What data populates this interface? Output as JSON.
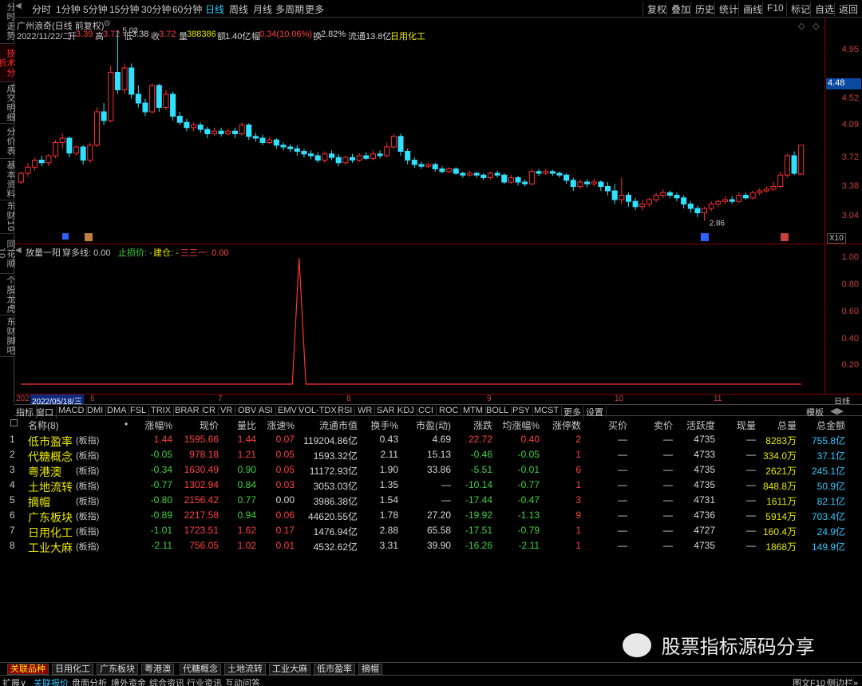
{
  "sidebar": [
    "分时走势",
    "技术分析",
    "成交明细",
    "分价表",
    "基本资料",
    "东财10",
    "同花顺10",
    "个股龙虎",
    "东财脚吧"
  ],
  "periods": [
    "分时",
    "1分钟",
    "5分钟",
    "15分钟",
    "30分钟",
    "60分钟",
    "日线",
    "周线",
    "月线",
    "多周期",
    "更多"
  ],
  "active_period": "日线",
  "right_menu": [
    "复权",
    "叠加",
    "历史",
    "统计",
    "画线",
    "F10",
    "标记",
    "自选",
    "返回"
  ],
  "info": {
    "stock_name": "广州浪奇(日线 前复权)",
    "date": "2022/11/22/二",
    "open_label": "开",
    "open": "3.39",
    "high_label": "高",
    "high": "3.72",
    "low_label": "低",
    "low": "3.38",
    "close_label": "收",
    "close": "3.72",
    "vol_label": "量",
    "vol": "388386",
    "amt_label": "额",
    "amt": "1.40亿",
    "chg_label": "幅",
    "chg": "0.34(10.06%)",
    "turn_label": "换",
    "turn": "2.82%",
    "float_label": "流通",
    "float": "13.8亿",
    "sector": "日用化工",
    "high_mark": "5.03",
    "low_mark": "2.86",
    "price_tag": "4.48"
  },
  "price_axis": [
    "4.95",
    "4.52",
    "4.09",
    "3.72",
    "3.38",
    "3.04"
  ],
  "x10": "X10",
  "sub": {
    "name": "放量一阳",
    "l1": "穿多线: 0.00",
    "l2": "止损价: -",
    "l3": "建仓: -",
    "l4": "三三一: 0.00"
  },
  "sub_axis": [
    "1.00",
    "0.80",
    "0.60",
    "0.40",
    "0.20"
  ],
  "dates": {
    "start": "2022/05/18/三",
    "prefix": "202",
    "months": [
      "6",
      "7",
      "8",
      "9",
      "10",
      "11"
    ],
    "period": "日线"
  },
  "indicators": [
    "指标",
    "窗口",
    "MACD",
    "DMI",
    "DMA",
    "FSL",
    "TRIX",
    "BRAR",
    "CR",
    "VR",
    "OBV",
    "ASI",
    "EMV",
    "VOL-TDX",
    "RSI",
    "WR",
    "SAR",
    "KDJ",
    "CCI",
    "ROC",
    "MTM",
    "BOLL",
    "PSY",
    "MCST",
    "更多",
    "设置"
  ],
  "template_label": "模板",
  "table": {
    "headers": [
      "名称(8)",
      "•",
      "涨幅%",
      "现价",
      "量比",
      "涨速%",
      "流通市值",
      "换手%",
      "市盈(动)",
      "涨跌",
      "均涨幅%",
      "涨停数",
      "买价",
      "卖价",
      "活跃度",
      "现量",
      "总量",
      "总金额"
    ],
    "rows": [
      [
        "1",
        "低市盈率",
        "(板指)",
        "1.44",
        "1595.66",
        "1.44",
        "0.07",
        "119204.86亿",
        "0.43",
        "4.69",
        "22.72",
        "0.40",
        "2",
        "—",
        "—",
        "4735",
        "—",
        "8283万",
        "755.8亿"
      ],
      [
        "2",
        "代糖概念",
        "(板指)",
        "-0.05",
        "978.18",
        "1.21",
        "0.05",
        "1593.32亿",
        "2.11",
        "15.13",
        "-0.46",
        "-0.05",
        "1",
        "—",
        "—",
        "4733",
        "—",
        "334.0万",
        "37.1亿"
      ],
      [
        "3",
        "粤港澳",
        "(板指)",
        "-0.34",
        "1630.49",
        "0.90",
        "0.05",
        "11172.93亿",
        "1.90",
        "33.86",
        "-5.51",
        "-0.01",
        "6",
        "—",
        "—",
        "4735",
        "—",
        "2621万",
        "245.1亿"
      ],
      [
        "4",
        "土地流转",
        "(板指)",
        "-0.77",
        "1302.94",
        "0.84",
        "0.03",
        "3053.03亿",
        "1.35",
        "—",
        "-10.14",
        "-0.77",
        "1",
        "—",
        "—",
        "4735",
        "—",
        "848.8万",
        "50.9亿"
      ],
      [
        "5",
        "摘帽",
        "(板指)",
        "-0.80",
        "2156.42",
        "0.77",
        "0.00",
        "3986.38亿",
        "1.54",
        "—",
        "-17.44",
        "-0.47",
        "3",
        "—",
        "—",
        "4731",
        "—",
        "1611万",
        "82.1亿"
      ],
      [
        "6",
        "广东板块",
        "(板指)",
        "-0.89",
        "2217.58",
        "0.94",
        "0.06",
        "44620.55亿",
        "1.78",
        "27.20",
        "-19.92",
        "-1.13",
        "9",
        "—",
        "—",
        "4736",
        "—",
        "5914万",
        "703.4亿"
      ],
      [
        "7",
        "日用化工",
        "(板指)",
        "-1.01",
        "1723.51",
        "1.62",
        "0.17",
        "1476.94亿",
        "2.88",
        "65.58",
        "-17.51",
        "-0.79",
        "1",
        "—",
        "—",
        "4727",
        "—",
        "160.4万",
        "24.9亿"
      ],
      [
        "8",
        "工业大麻",
        "(板指)",
        "-2.11",
        "756.05",
        "1.02",
        "0.01",
        "4532.62亿",
        "3.31",
        "39.90",
        "-16.26",
        "-2.11",
        "1",
        "—",
        "—",
        "4735",
        "—",
        "1868万",
        "149.9亿"
      ]
    ]
  },
  "watermark": "股票指标源码分享",
  "bottom_tabs": [
    "关联品种",
    "日用化工",
    "广东板块",
    "粤港澳",
    "代糖概念",
    "土地流转",
    "工业大麻",
    "低市盈率",
    "摘帽"
  ],
  "status": [
    "扩展∨",
    "关联报价",
    "盘面分析",
    "境外资金",
    "综合资讯",
    "行业资讯",
    "互动问答"
  ],
  "status_right": [
    "图文F10",
    "侧边栏»"
  ],
  "chart_data": {
    "type": "candlestick",
    "ylim": [
      2.7,
      5.1
    ],
    "price_labels": [
      "4.95",
      "4.52",
      "4.09",
      "3.72",
      "3.38",
      "3.04"
    ],
    "high": 5.03,
    "low": 2.86,
    "candles": [
      [
        3.3,
        3.4,
        3.28,
        3.42
      ],
      [
        3.4,
        3.47,
        3.36,
        3.52
      ],
      [
        3.47,
        3.55,
        3.43,
        3.58
      ],
      [
        3.55,
        3.52,
        3.48,
        3.6
      ],
      [
        3.52,
        3.6,
        3.48,
        3.62
      ],
      [
        3.6,
        3.75,
        3.57,
        3.78
      ],
      [
        3.75,
        3.8,
        3.68,
        3.85
      ],
      [
        3.8,
        3.63,
        3.58,
        3.82
      ],
      [
        3.63,
        3.7,
        3.6,
        3.72
      ],
      [
        3.7,
        3.55,
        3.5,
        3.72
      ],
      [
        3.55,
        3.72,
        3.52,
        3.75
      ],
      [
        3.72,
        4.1,
        3.7,
        4.15
      ],
      [
        4.1,
        4.0,
        3.95,
        4.2
      ],
      [
        4.0,
        4.55,
        3.98,
        4.62
      ],
      [
        4.55,
        4.35,
        4.3,
        5.03
      ],
      [
        4.35,
        4.6,
        4.3,
        4.65
      ],
      [
        4.6,
        4.3,
        4.25,
        4.65
      ],
      [
        4.3,
        4.2,
        4.15,
        4.4
      ],
      [
        4.2,
        4.1,
        4.05,
        4.25
      ],
      [
        4.1,
        4.4,
        4.08,
        4.42
      ],
      [
        4.4,
        4.15,
        4.1,
        4.42
      ],
      [
        4.15,
        4.3,
        4.12,
        4.35
      ],
      [
        4.3,
        4.05,
        4.0,
        4.33
      ],
      [
        4.05,
        3.98,
        3.95,
        4.1
      ],
      [
        3.98,
        3.92,
        3.88,
        4.02
      ],
      [
        3.92,
        3.95,
        3.88,
        3.98
      ],
      [
        3.95,
        3.9,
        3.86,
        3.98
      ],
      [
        3.9,
        3.85,
        3.8,
        3.93
      ],
      [
        3.85,
        3.88,
        3.83,
        3.92
      ],
      [
        3.88,
        3.85,
        3.82,
        3.92
      ],
      [
        3.85,
        3.88,
        3.83,
        3.91
      ],
      [
        3.88,
        3.85,
        3.8,
        3.92
      ],
      [
        3.85,
        3.95,
        3.83,
        3.98
      ],
      [
        3.95,
        3.82,
        3.78,
        3.97
      ],
      [
        3.82,
        3.8,
        3.76,
        3.86
      ],
      [
        3.8,
        3.75,
        3.72,
        3.84
      ],
      [
        3.75,
        3.78,
        3.73,
        3.81
      ],
      [
        3.78,
        3.72,
        3.68,
        3.8
      ],
      [
        3.72,
        3.7,
        3.66,
        3.75
      ],
      [
        3.7,
        3.68,
        3.64,
        3.73
      ],
      [
        3.68,
        3.65,
        3.6,
        3.72
      ],
      [
        3.65,
        3.62,
        3.58,
        3.68
      ],
      [
        3.62,
        3.6,
        3.56,
        3.66
      ],
      [
        3.6,
        3.55,
        3.52,
        3.64
      ],
      [
        3.55,
        3.62,
        3.52,
        3.65
      ],
      [
        3.62,
        3.58,
        3.55,
        3.66
      ],
      [
        3.58,
        3.52,
        3.48,
        3.62
      ],
      [
        3.52,
        3.58,
        3.5,
        3.6
      ],
      [
        3.58,
        3.55,
        3.52,
        3.62
      ],
      [
        3.55,
        3.6,
        3.53,
        3.63
      ],
      [
        3.6,
        3.57,
        3.55,
        3.64
      ],
      [
        3.57,
        3.62,
        3.55,
        3.66
      ],
      [
        3.62,
        3.6,
        3.57,
        3.66
      ],
      [
        3.6,
        3.7,
        3.58,
        3.75
      ],
      [
        3.7,
        3.82,
        3.68,
        3.85
      ],
      [
        3.82,
        3.65,
        3.6,
        3.85
      ],
      [
        3.65,
        3.55,
        3.5,
        3.68
      ],
      [
        3.55,
        3.5,
        3.46,
        3.58
      ],
      [
        3.5,
        3.48,
        3.45,
        3.53
      ],
      [
        3.48,
        3.5,
        3.46,
        3.52
      ],
      [
        3.5,
        3.45,
        3.42,
        3.52
      ],
      [
        3.45,
        3.42,
        3.4,
        3.48
      ],
      [
        3.42,
        3.45,
        3.4,
        3.47
      ],
      [
        3.45,
        3.4,
        3.38,
        3.47
      ],
      [
        3.4,
        3.38,
        3.35,
        3.42
      ],
      [
        3.38,
        3.4,
        3.36,
        3.43
      ],
      [
        3.4,
        3.38,
        3.35,
        3.42
      ],
      [
        3.38,
        3.35,
        3.32,
        3.4
      ],
      [
        3.35,
        3.4,
        3.33,
        3.42
      ],
      [
        3.4,
        3.38,
        3.35,
        3.43
      ],
      [
        3.38,
        3.3,
        3.28,
        3.4
      ],
      [
        3.3,
        3.35,
        3.28,
        3.38
      ],
      [
        3.35,
        3.3,
        3.26,
        3.37
      ],
      [
        3.3,
        3.28,
        3.25,
        3.33
      ],
      [
        3.28,
        3.42,
        3.26,
        3.45
      ],
      [
        3.42,
        3.4,
        3.37,
        3.45
      ],
      [
        3.4,
        3.42,
        3.38,
        3.45
      ],
      [
        3.42,
        3.4,
        3.37,
        3.44
      ],
      [
        3.4,
        3.38,
        3.35,
        3.42
      ],
      [
        3.38,
        3.32,
        3.28,
        3.4
      ],
      [
        3.32,
        3.25,
        3.2,
        3.35
      ],
      [
        3.25,
        3.3,
        3.22,
        3.33
      ],
      [
        3.3,
        3.28,
        3.24,
        3.33
      ],
      [
        3.28,
        3.3,
        3.25,
        3.34
      ],
      [
        3.3,
        3.25,
        3.2,
        3.32
      ],
      [
        3.25,
        3.2,
        3.15,
        3.3
      ],
      [
        3.2,
        3.1,
        3.05,
        3.28
      ],
      [
        3.1,
        3.15,
        3.05,
        3.35
      ],
      [
        3.15,
        3.08,
        3.02,
        3.18
      ],
      [
        3.08,
        3.02,
        2.98,
        3.12
      ],
      [
        3.02,
        3.05,
        2.98,
        3.1
      ],
      [
        3.05,
        3.1,
        3.02,
        3.12
      ],
      [
        3.1,
        3.15,
        3.07,
        3.18
      ],
      [
        3.15,
        3.18,
        3.12,
        3.22
      ],
      [
        3.18,
        3.15,
        3.12,
        3.2
      ],
      [
        3.15,
        3.12,
        3.08,
        3.18
      ],
      [
        3.12,
        3.05,
        3.0,
        3.15
      ],
      [
        3.05,
        3.0,
        2.95,
        3.08
      ],
      [
        3.0,
        2.95,
        2.9,
        3.03
      ],
      [
        2.95,
        3.0,
        2.86,
        3.02
      ],
      [
        3.0,
        3.05,
        2.97,
        3.08
      ],
      [
        3.05,
        3.08,
        3.02,
        3.1
      ],
      [
        3.08,
        3.1,
        3.05,
        3.14
      ],
      [
        3.1,
        3.08,
        3.05,
        3.14
      ],
      [
        3.08,
        3.15,
        3.06,
        3.18
      ],
      [
        3.15,
        3.12,
        3.1,
        3.18
      ],
      [
        3.12,
        3.18,
        3.1,
        3.2
      ],
      [
        3.18,
        3.2,
        3.15,
        3.23
      ],
      [
        3.2,
        3.22,
        3.18,
        3.25
      ],
      [
        3.22,
        3.25,
        3.2,
        3.3
      ],
      [
        3.25,
        3.38,
        3.23,
        3.42
      ],
      [
        3.38,
        3.6,
        3.35,
        3.62
      ],
      [
        3.6,
        3.4,
        3.38,
        3.65
      ],
      [
        3.39,
        3.72,
        3.38,
        3.72
      ]
    ]
  },
  "sub_chart": {
    "type": "line",
    "ylim": [
      0,
      1
    ],
    "values": [
      0,
      0,
      0,
      0,
      0,
      0,
      0,
      0,
      0,
      0,
      0,
      0,
      0,
      0,
      0,
      0,
      0,
      0,
      0,
      0,
      0,
      0,
      0,
      0,
      0,
      0,
      0,
      0,
      0,
      0,
      0,
      0,
      0,
      0,
      0,
      0,
      0,
      0,
      0,
      0,
      0,
      1,
      0,
      0,
      0,
      0,
      0,
      0,
      0,
      0,
      0,
      0,
      0,
      0,
      0,
      0,
      0,
      0,
      0,
      0,
      0,
      0,
      0,
      0,
      0,
      0,
      0,
      0,
      0,
      0,
      0,
      0,
      0,
      0,
      0,
      0,
      0,
      0,
      0,
      0,
      0,
      0,
      0,
      0,
      0,
      0,
      0,
      0,
      0,
      0,
      0,
      0,
      0,
      0,
      0,
      0,
      0,
      0,
      0,
      0,
      0,
      0,
      0,
      0,
      0,
      0,
      0,
      0,
      0,
      0,
      0,
      0,
      0,
      0,
      0,
      0
    ]
  }
}
